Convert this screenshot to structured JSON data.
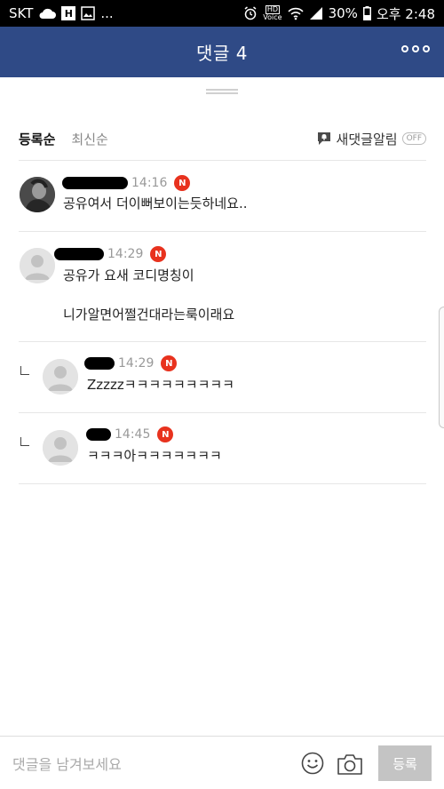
{
  "status_bar": {
    "carrier": "SKT",
    "extra": "...",
    "hd_label": "HD",
    "voice_label": "Voice",
    "battery": "30%",
    "time": "오후 2:48"
  },
  "header": {
    "title": "댓글 4"
  },
  "sort": {
    "tabs": [
      {
        "label": "등록순",
        "active": true
      },
      {
        "label": "최신순",
        "active": false
      }
    ],
    "alarm_label": "새댓글알림",
    "alarm_state": "OFF"
  },
  "comments": [
    {
      "time": "14:16",
      "badge": "N",
      "text_lines": [
        "공유여서 더이뻐보이는듯하네요.."
      ],
      "is_reply": false
    },
    {
      "time": "14:29",
      "badge": "N",
      "text_lines": [
        "공유가 요새 코디명칭이",
        "니가알면어쩔건대라는룩이래요"
      ],
      "is_reply": false
    },
    {
      "time": "14:29",
      "badge": "N",
      "text_lines": [
        "Zzzzzㅋㅋㅋㅋㅋㅋㅋㅋㅋ"
      ],
      "is_reply": true
    },
    {
      "time": "14:45",
      "badge": "N",
      "text_lines": [
        "ㅋㅋㅋ아ㅋㅋㅋㅋㅋㅋㅋ"
      ],
      "is_reply": true
    }
  ],
  "input": {
    "placeholder": "댓글을 남겨보세요",
    "submit_label": "등록"
  },
  "colors": {
    "header_bg": "#2f4a86",
    "badge_red": "#e8321e",
    "submit_bg": "#c4c4c4"
  }
}
